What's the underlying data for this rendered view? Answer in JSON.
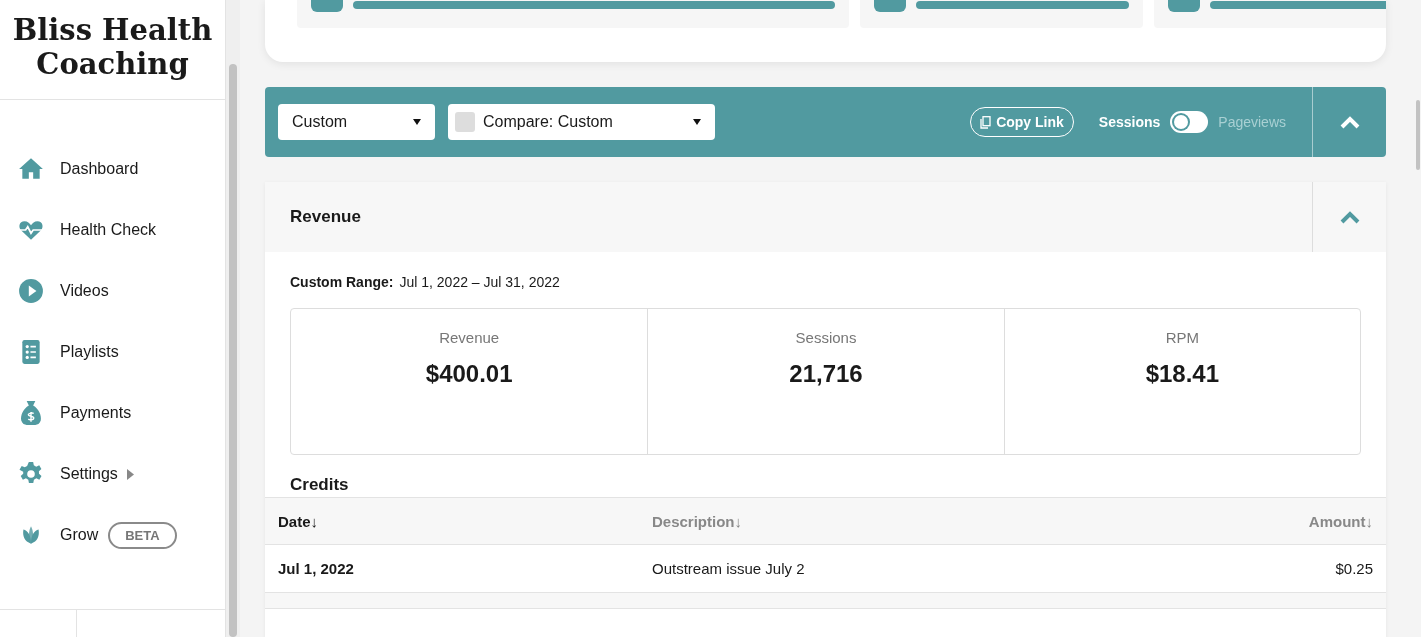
{
  "sidebar": {
    "logo": "Bliss Health Coaching",
    "items": [
      {
        "kind": "home",
        "label": "Dashboard"
      },
      {
        "kind": "heart",
        "label": "Health Check"
      },
      {
        "kind": "play",
        "label": "Videos"
      },
      {
        "kind": "list",
        "label": "Playlists"
      },
      {
        "kind": "money",
        "label": "Payments"
      },
      {
        "kind": "gear",
        "label": "Settings",
        "submenu": true
      },
      {
        "kind": "leaf",
        "label": "Grow",
        "badge": "BETA"
      }
    ]
  },
  "toolbar": {
    "range_select": "Custom",
    "compare_select": "Compare: Custom",
    "copy_link": "Copy Link",
    "metric_toggle": {
      "left_label": "Sessions",
      "right_label": "Pageviews",
      "on": false
    }
  },
  "revenue_panel": {
    "title": "Revenue",
    "range_label": "Custom Range:",
    "range_value": "Jul 1, 2022 – Jul 31, 2022",
    "stats": [
      {
        "label": "Revenue",
        "value": "$400.01"
      },
      {
        "label": "Sessions",
        "value": "21,716"
      },
      {
        "label": "RPM",
        "value": "$18.41"
      }
    ],
    "credits": {
      "title": "Credits",
      "columns": [
        {
          "label": "Date↓",
          "selected": true
        },
        {
          "label": "Description↓",
          "selected": false
        },
        {
          "label": "Amount↓",
          "selected": false
        }
      ],
      "rows": [
        [
          "Jul 1, 2022",
          "Outstream issue July 2",
          "$0.25"
        ]
      ]
    }
  }
}
